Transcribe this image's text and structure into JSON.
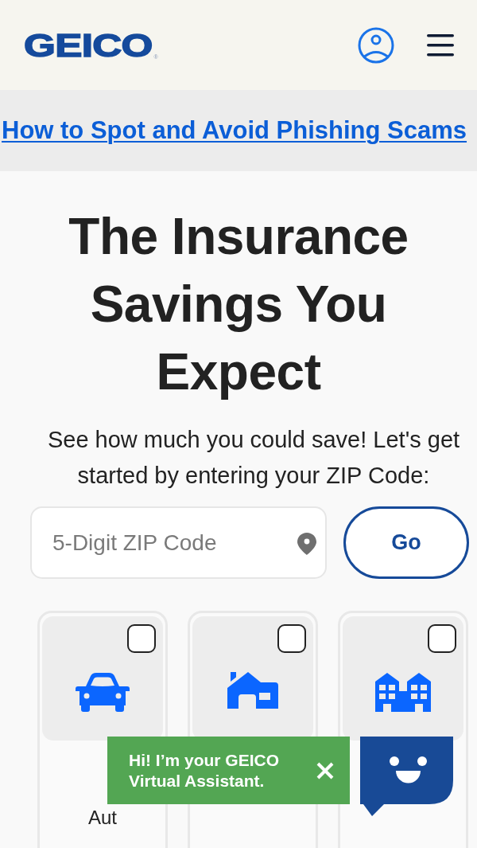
{
  "header": {
    "logo": {
      "text": "GEICO",
      "mark": "®"
    }
  },
  "alert_banner": {
    "link": "How to Spot and Avoid Phishing Scams"
  },
  "hero": {
    "title": "The Insurance Savings You Expect",
    "subtitle": "See how much you could save! Let's get started by entering your ZIP Code:"
  },
  "zip_form": {
    "placeholder": "5-Digit ZIP Code",
    "button": "Go"
  },
  "products": [
    {
      "kind": "car",
      "checked": false,
      "label": "Aut"
    },
    {
      "kind": "house",
      "checked": false
    },
    {
      "kind": "buildings",
      "checked": false
    }
  ],
  "chat": {
    "greeting": "Hi! I’m your GEICO Virtual Assistant."
  }
}
